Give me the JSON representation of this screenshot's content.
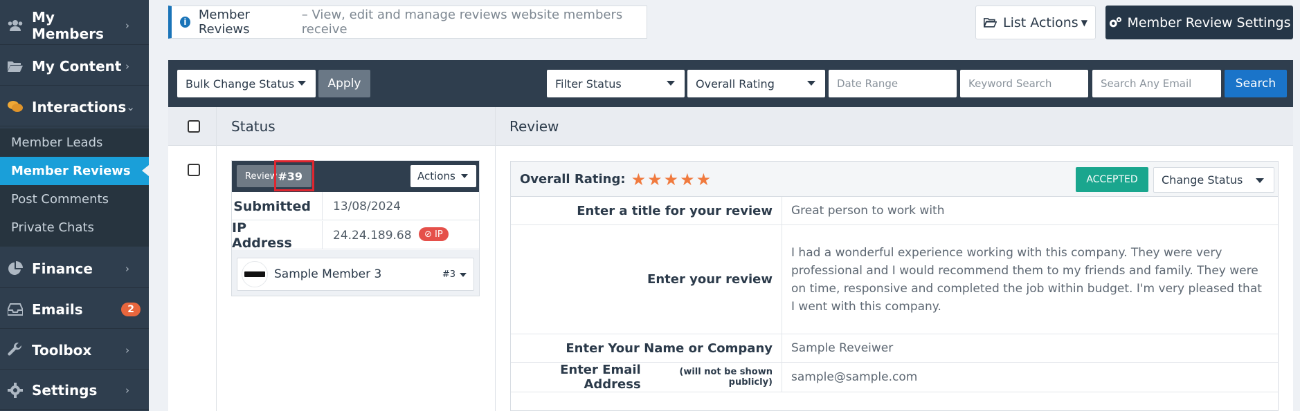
{
  "sidebar": {
    "items": [
      {
        "label": "My Members",
        "icon": "users-icon"
      },
      {
        "label": "My Content",
        "icon": "folder-open-icon"
      },
      {
        "label": "Interactions",
        "icon": "comments-icon"
      },
      {
        "label": "Finance",
        "icon": "pie-chart-icon"
      },
      {
        "label": "Emails",
        "icon": "inbox-icon",
        "badge": "2"
      },
      {
        "label": "Toolbox",
        "icon": "wrench-icon"
      },
      {
        "label": "Settings",
        "icon": "gear-icon"
      }
    ],
    "subitems": [
      {
        "label": "Member Leads"
      },
      {
        "label": "Member Reviews",
        "active": true
      },
      {
        "label": "Post Comments"
      },
      {
        "label": "Private Chats"
      }
    ]
  },
  "header": {
    "info_title": "Member Reviews",
    "info_desc": "– View, edit and manage reviews website members receive",
    "list_actions_label": "List Actions",
    "settings_label": "Member Review Settings"
  },
  "filters": {
    "bulk_change_status": "Bulk Change Status",
    "apply_label": "Apply",
    "filter_status": "Filter Status",
    "overall_rating": "Overall Rating",
    "date_range_placeholder": "Date Range",
    "keyword_placeholder": "Keyword Search",
    "email_placeholder": "Search Any Email",
    "search_label": "Search"
  },
  "table": {
    "headers": {
      "status": "Status",
      "review": "Review"
    }
  },
  "review_item": {
    "chip_label": "Review",
    "chip_number": "#39",
    "actions_label": "Actions",
    "submitted_label": "Submitted",
    "submitted_value": "13/08/2024",
    "ip_label": "IP Address",
    "ip_value": "24.24.189.68",
    "ip_badge": "⊘ IP",
    "member_name": "Sample Member 3",
    "member_number": "#3",
    "overall_rating_label": "Overall Rating:",
    "rating": 5,
    "status_badge": "ACCEPTED",
    "change_status_label": "Change Status",
    "fields": [
      {
        "label": "Enter a title for your review",
        "value": "Great person to work with"
      },
      {
        "label": "Enter your review",
        "value": "I had a wonderful experience working with this company. They were very professional and I would recommend them to my friends and family. They were on time, responsive and completed the job within budget. I'm very pleased that I went with this company."
      },
      {
        "label": "Enter Your Name or Company",
        "value": "Sample Reveiwer"
      },
      {
        "label": "Enter Email Address",
        "label_note": "(will not be shown publicly)",
        "value": "sample@sample.com"
      }
    ]
  },
  "colors": {
    "sidebar_bg": "#2f3e4e",
    "active_item": "#1a9fd9",
    "accepted": "#1aa68e",
    "star": "#f07a3e",
    "search_button": "#1a74c9",
    "highlight_box": "#e0262f"
  }
}
